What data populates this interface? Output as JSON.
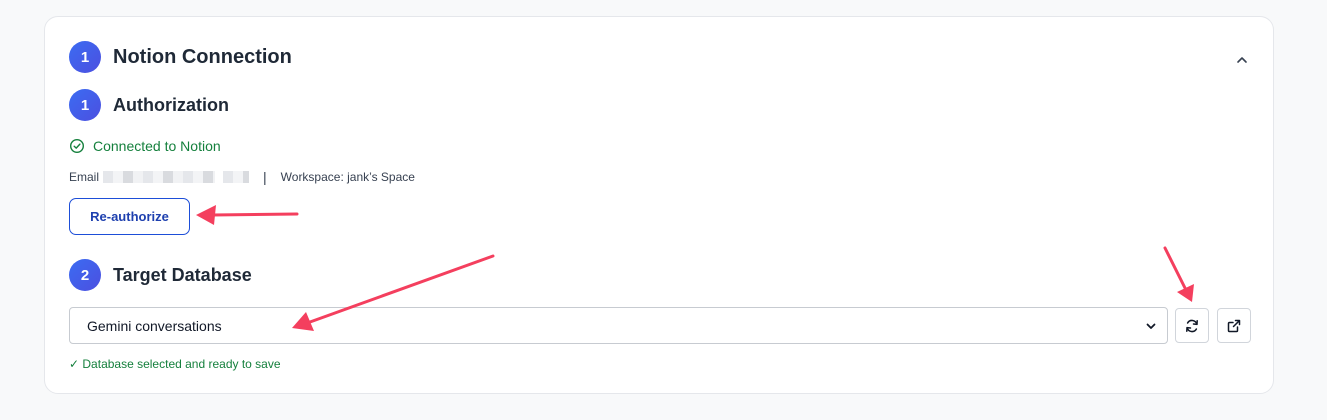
{
  "section": {
    "step_number": "1",
    "title": "Notion Connection"
  },
  "authorization": {
    "step_number": "1",
    "title": "Authorization",
    "status_text": "Connected to Notion",
    "email_label": "Email",
    "workspace_text": "Workspace: jank’s Space",
    "separator": "|",
    "reauthorize_label": "Re-authorize"
  },
  "target_database": {
    "step_number": "2",
    "title": "Target Database",
    "selected_value": "Gemini conversations",
    "status_message": "✓ Database selected and ready to save"
  },
  "icons": {
    "collapse": "chevron-up-icon",
    "status": "check-circle-icon",
    "dropdown": "chevron-down-icon",
    "refresh": "refresh-icon",
    "open": "external-link-icon"
  },
  "colors": {
    "accent": "#3b6cf2",
    "success": "#15803d",
    "button_border": "#1d4ed8",
    "annotation_arrow": "#f43f5e"
  }
}
